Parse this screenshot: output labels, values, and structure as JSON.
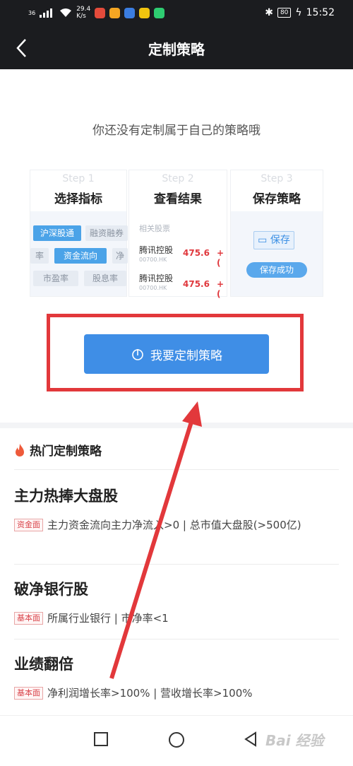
{
  "status": {
    "net_type": "36",
    "net_speed_value": "29.4",
    "net_speed_unit": "K/s",
    "battery": "80",
    "time": "15:52",
    "app_icons": [
      "#e44b3b",
      "#f5a623",
      "#3b7de0",
      "#f1c40f",
      "#2ecc71"
    ]
  },
  "nav": {
    "title": "定制策略"
  },
  "empty_tip": "你还没有定制属于自己的策略哦",
  "steps": [
    {
      "no": "Step 1",
      "title": "选择指标",
      "chips": [
        "沪深股通",
        "融资融券",
        "率",
        "资金流向",
        "净",
        "市盈率",
        "股息率"
      ]
    },
    {
      "no": "Step 2",
      "title": "查看结果",
      "header": "相关股票",
      "rows": [
        {
          "name": "腾讯控股",
          "code": "00700.HK",
          "price": "475.6",
          "change": "+("
        },
        {
          "name": "腾讯控股",
          "code": "00700.HK",
          "price": "475.6",
          "change": "+("
        }
      ]
    },
    {
      "no": "Step 3",
      "title": "保存策略",
      "save_label": "保存",
      "saved_label": "保存成功"
    }
  ],
  "cta": {
    "label": "我要定制策略"
  },
  "hot": {
    "title": "热门定制策略",
    "items": [
      {
        "name": "主力热捧大盘股",
        "tag": "资金面",
        "desc": "主力资金流向主力净流入>0 | 总市值大盘股(>500亿)"
      },
      {
        "name": "破净银行股",
        "tag": "基本面",
        "desc": "所属行业银行 | 市净率<1"
      },
      {
        "name": "业绩翻倍",
        "tag": "基本面",
        "desc": "净利润增长率>100% | 营收增长率>100%"
      }
    ]
  },
  "watermark": "Bai 经验",
  "colors": {
    "header_bg": "#1b1c1f",
    "primary": "#3f8ee6",
    "highlight_border": "#e2383b",
    "annotation_arrow": "#e2383b"
  }
}
